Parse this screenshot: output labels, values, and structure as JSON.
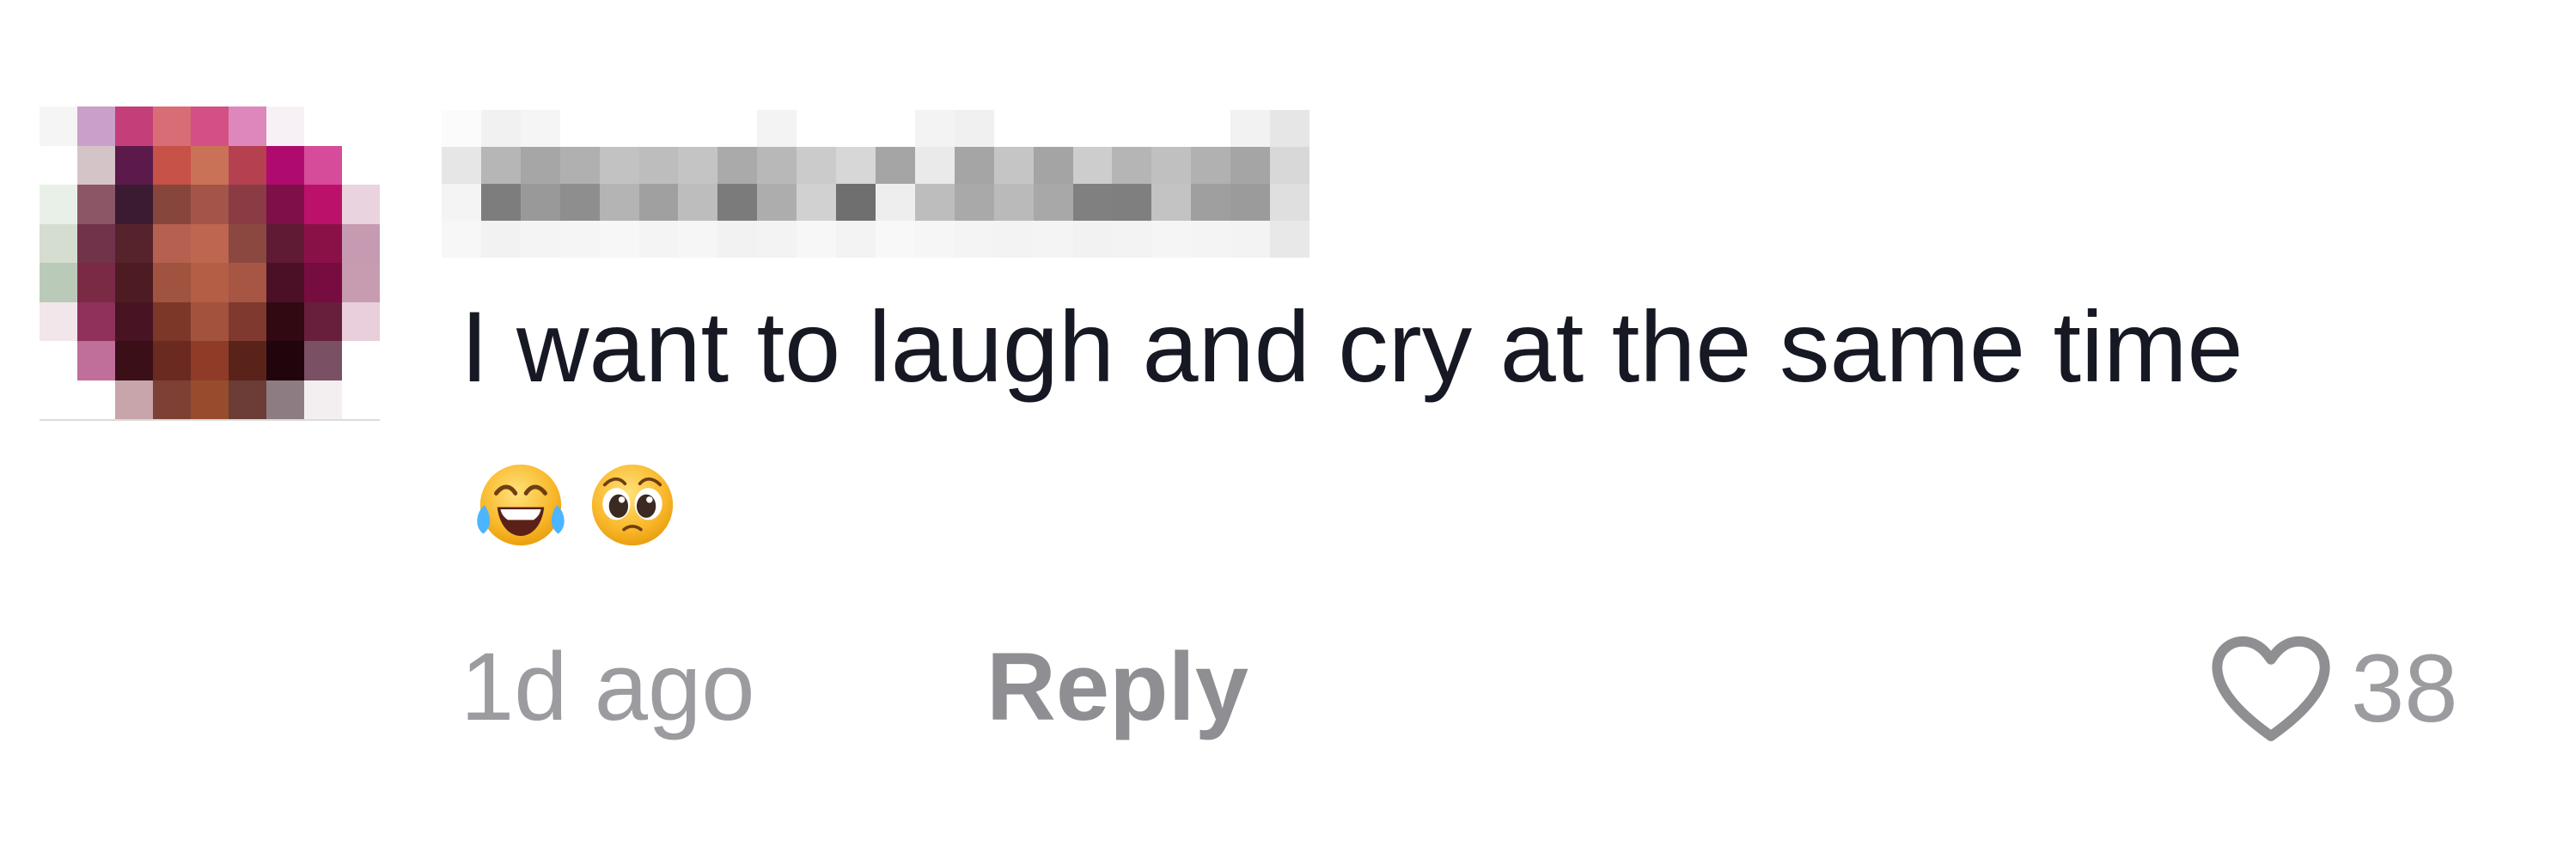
{
  "comment": {
    "avatar": {
      "icon": "pixelated-avatar",
      "pixels": [
        [
          "#f5f5f5",
          "#ca9fc8",
          "#c43e7a",
          "#d86d75",
          "#d44f83",
          "#dd87bc",
          "#f7f1f5",
          "#ffffff",
          "#ffffff"
        ],
        [
          "#ffffff",
          "#d4c4c8",
          "#5c1a4b",
          "#c75247",
          "#c97258",
          "#b54150",
          "#af0b6f",
          "#d64c9a",
          "#ffffff"
        ],
        [
          "#e8f0e8",
          "#8d5667",
          "#3a1b31",
          "#86463c",
          "#a4554a",
          "#8a3b43",
          "#7e0f48",
          "#bc116b",
          "#e9d3de"
        ],
        [
          "#d4ddd0",
          "#70334a",
          "#56232c",
          "#b66050",
          "#be664f",
          "#8a4841",
          "#5f1a34",
          "#8a1148",
          "#c69bb1"
        ],
        [
          "#b9cbb8",
          "#7b2a46",
          "#4d1b22",
          "#a0533f",
          "#b35e45",
          "#a65643",
          "#4b1025",
          "#760c3f",
          "#c79bb0"
        ],
        [
          "#f2e6ea",
          "#8f315b",
          "#481322",
          "#7d3729",
          "#a3533d",
          "#7f392e",
          "#300912",
          "#671f3c",
          "#e8cfdb"
        ],
        [
          "#ffffff",
          "#bf6f99",
          "#3a0f18",
          "#6b2a1f",
          "#8f3b28",
          "#5a231a",
          "#22040d",
          "#7a5064",
          "#ffffff"
        ],
        [
          "#ffffff",
          "#ffffff",
          "#c7a5aa",
          "#7c4035",
          "#974d2d",
          "#6c3c36",
          "#8d7d83",
          "#f3eff1",
          "#ffffff"
        ]
      ]
    },
    "username": {
      "icon": "pixelated-username",
      "pixels": [
        [
          "#fbfbfb",
          "#f1f1f1",
          "#f5f5f5",
          "#ffffff",
          "#ffffff",
          "#ffffff",
          "#ffffff",
          "#ffffff",
          "#f3f3f3",
          "#ffffff",
          "#ffffff",
          "#ffffff",
          "#f3f3f3",
          "#f0f0f0",
          "#ffffff",
          "#ffffff",
          "#ffffff",
          "#ffffff",
          "#ffffff",
          "#ffffff",
          "#f2f2f2",
          "#e6e6e6"
        ],
        [
          "#e6e6e6",
          "#b6b6b6",
          "#a6a6a6",
          "#b0b0b0",
          "#c2c2c2",
          "#bdbdbd",
          "#c4c4c4",
          "#aaaaaa",
          "#b8b8b8",
          "#cbcbcb",
          "#d7d7d7",
          "#a5a5a5",
          "#eaeaea",
          "#a5a5a5",
          "#c5c5c5",
          "#a4a4a4",
          "#cdcdcd",
          "#b5b5b5",
          "#c0c0c0",
          "#b1b1b1",
          "#a5a5a5",
          "#d8d8d8"
        ],
        [
          "#f4f4f4",
          "#7d7d7d",
          "#999999",
          "#8e8e8e",
          "#b4b4b4",
          "#a0a0a0",
          "#bdbdbd",
          "#7b7b7b",
          "#adadad",
          "#d1d1d1",
          "#6f6f6f",
          "#eeeeee",
          "#bdbdbd",
          "#a9a9a9",
          "#bababa",
          "#a8a8a8",
          "#808080",
          "#7f7f7f",
          "#c3c3c3",
          "#9f9f9f",
          "#9b9b9b",
          "#dfdfdf"
        ],
        [
          "#f7f7f7",
          "#f2f2f2",
          "#f4f4f4",
          "#f5f5f5",
          "#f7f7f7",
          "#f4f4f4",
          "#f6f6f6",
          "#f2f2f2",
          "#f3f3f3",
          "#f7f7f7",
          "#f3f3f3",
          "#f8f8f8",
          "#f6f6f6",
          "#f4f4f4",
          "#f3f3f3",
          "#f4f4f4",
          "#f2f2f2",
          "#f3f3f3",
          "#f5f5f5",
          "#f4f4f4",
          "#f3f3f3",
          "#e8e8e8"
        ]
      ]
    },
    "text": "I want to laugh and cry at the same time",
    "emojis": [
      "laughing-crying-emoji",
      "pleading-face-emoji"
    ],
    "timestamp": "1d ago",
    "reply_label": "Reply",
    "like": {
      "icon": "heart-icon",
      "count": "38"
    },
    "colors": {
      "text": "#161823",
      "meta": "#9b9ba0",
      "background": "#ffffff"
    }
  }
}
